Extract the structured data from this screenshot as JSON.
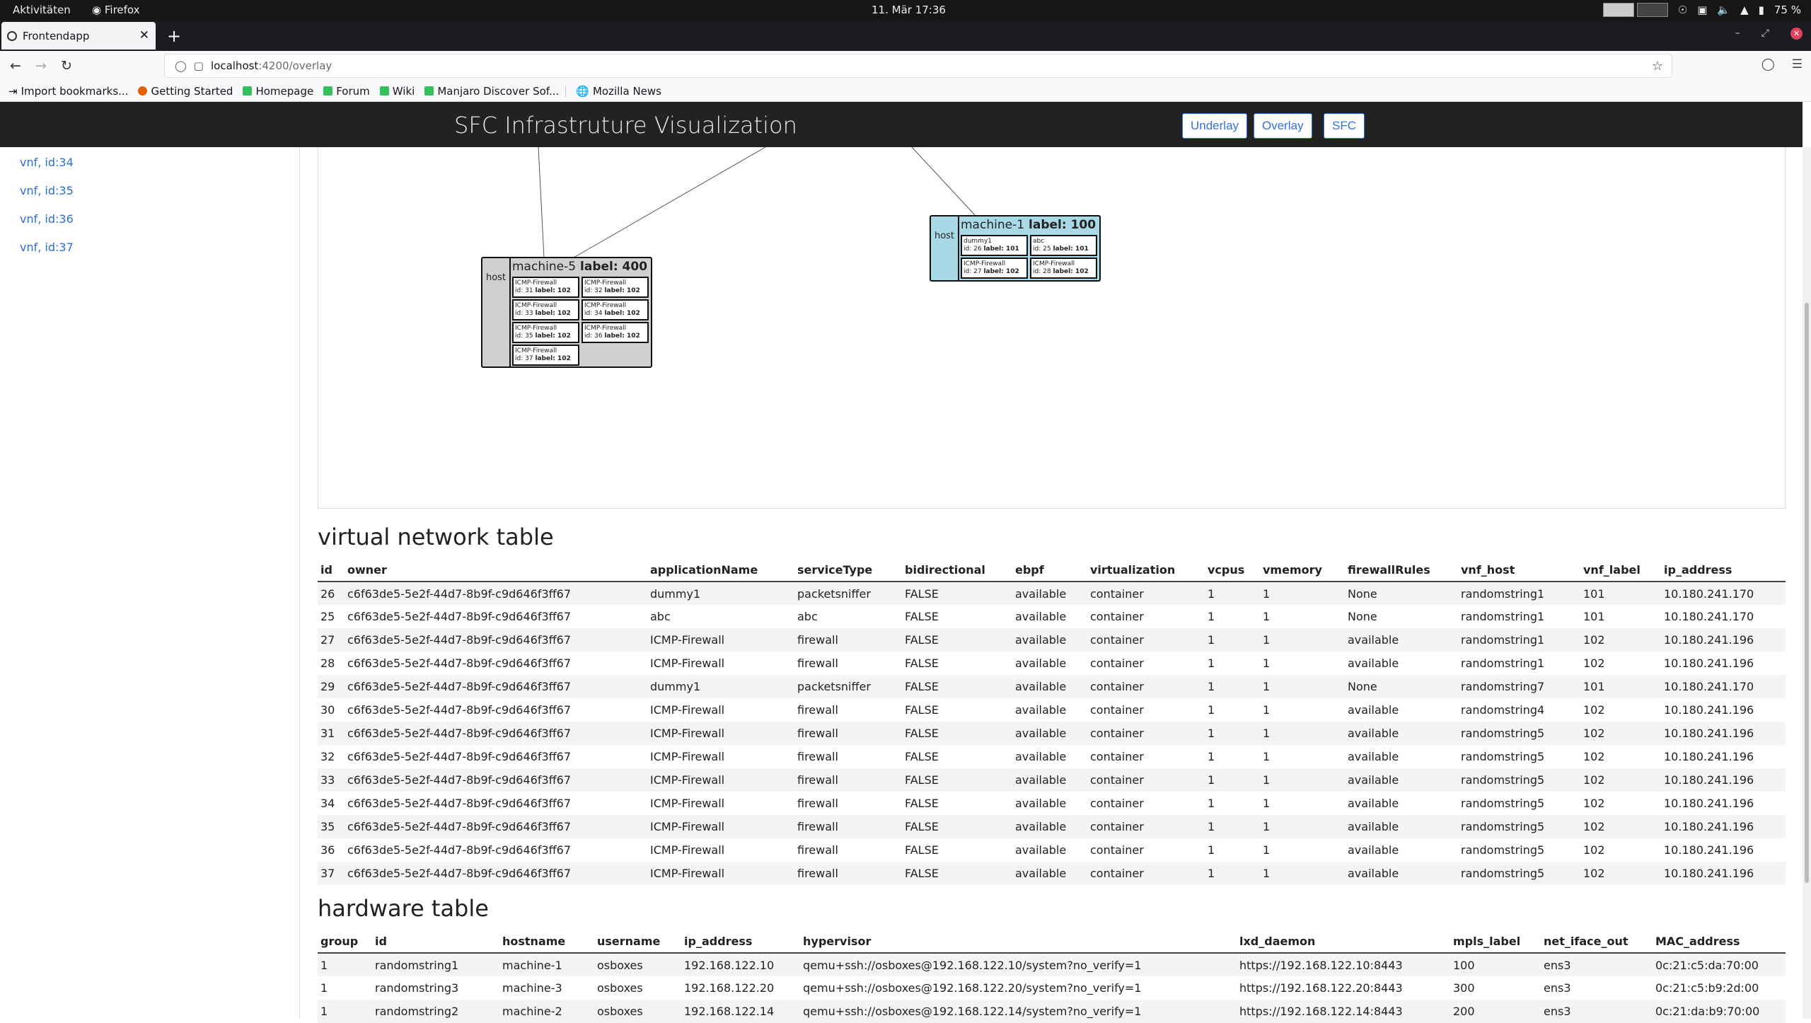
{
  "gnome": {
    "activities": "Aktivitäten",
    "app": "Firefox",
    "clock": "11. Mär  17:36",
    "battery": "75 %"
  },
  "browser": {
    "tab_title": "Frontendapp",
    "url_host": "localhost",
    "url_path": ":4200/overlay"
  },
  "bookmarks": [
    "Import bookmarks...",
    "Getting Started",
    "Homepage",
    "Forum",
    "Wiki",
    "Manjaro Discover Sof...",
    "Mozilla News"
  ],
  "app": {
    "title": "SFC Infrastruture Visualization",
    "buttons": [
      "Underlay",
      "Overlay",
      "SFC"
    ]
  },
  "sidebar": {
    "items": [
      "vnf, id:34",
      "vnf, id:35",
      "vnf, id:36",
      "vnf, id:37"
    ]
  },
  "graph": {
    "host_label": "host",
    "machines": [
      {
        "name": "machine-5",
        "label": "label: 400",
        "vnfs": [
          {
            "name": "ICMP-Firewall",
            "id": "id: 31",
            "label": "label: 102"
          },
          {
            "name": "ICMP-Firewall",
            "id": "id: 32",
            "label": "label: 102"
          },
          {
            "name": "ICMP-Firewall",
            "id": "id: 33",
            "label": "label: 102"
          },
          {
            "name": "ICMP-Firewall",
            "id": "id: 34",
            "label": "label: 102"
          },
          {
            "name": "ICMP-Firewall",
            "id": "id: 35",
            "label": "label: 102"
          },
          {
            "name": "ICMP-Firewall",
            "id": "id: 36",
            "label": "label: 102"
          },
          {
            "name": "ICMP-Firewall",
            "id": "id: 37",
            "label": "label: 102"
          }
        ]
      },
      {
        "name": "machine-1",
        "label": "label: 100",
        "vnfs": [
          {
            "name": "dummy1",
            "id": "id: 26",
            "label": "label: 101"
          },
          {
            "name": "abc",
            "id": "id: 25",
            "label": "label: 101"
          },
          {
            "name": "ICMP-Firewall",
            "id": "id: 27",
            "label": "label: 102"
          },
          {
            "name": "ICMP-Firewall",
            "id": "id: 28",
            "label": "label: 102"
          }
        ]
      }
    ]
  },
  "vnet": {
    "title": "virtual network table",
    "headers": [
      "id",
      "owner",
      "applicationName",
      "serviceType",
      "bidirectional",
      "ebpf",
      "virtualization",
      "vcpus",
      "vmemory",
      "firewallRules",
      "vnf_host",
      "vnf_label",
      "ip_address"
    ],
    "rows": [
      [
        "26",
        "c6f63de5-5e2f-44d7-8b9f-c9d646f3ff67",
        "dummy1",
        "packetsniffer",
        "FALSE",
        "available",
        "container",
        "1",
        "1",
        "None",
        "randomstring1",
        "101",
        "10.180.241.170"
      ],
      [
        "25",
        "c6f63de5-5e2f-44d7-8b9f-c9d646f3ff67",
        "abc",
        "abc",
        "FALSE",
        "available",
        "container",
        "1",
        "1",
        "None",
        "randomstring1",
        "101",
        "10.180.241.170"
      ],
      [
        "27",
        "c6f63de5-5e2f-44d7-8b9f-c9d646f3ff67",
        "ICMP-Firewall",
        "firewall",
        "FALSE",
        "available",
        "container",
        "1",
        "1",
        "available",
        "randomstring1",
        "102",
        "10.180.241.196"
      ],
      [
        "28",
        "c6f63de5-5e2f-44d7-8b9f-c9d646f3ff67",
        "ICMP-Firewall",
        "firewall",
        "FALSE",
        "available",
        "container",
        "1",
        "1",
        "available",
        "randomstring1",
        "102",
        "10.180.241.196"
      ],
      [
        "29",
        "c6f63de5-5e2f-44d7-8b9f-c9d646f3ff67",
        "dummy1",
        "packetsniffer",
        "FALSE",
        "available",
        "container",
        "1",
        "1",
        "None",
        "randomstring7",
        "101",
        "10.180.241.170"
      ],
      [
        "30",
        "c6f63de5-5e2f-44d7-8b9f-c9d646f3ff67",
        "ICMP-Firewall",
        "firewall",
        "FALSE",
        "available",
        "container",
        "1",
        "1",
        "available",
        "randomstring4",
        "102",
        "10.180.241.196"
      ],
      [
        "31",
        "c6f63de5-5e2f-44d7-8b9f-c9d646f3ff67",
        "ICMP-Firewall",
        "firewall",
        "FALSE",
        "available",
        "container",
        "1",
        "1",
        "available",
        "randomstring5",
        "102",
        "10.180.241.196"
      ],
      [
        "32",
        "c6f63de5-5e2f-44d7-8b9f-c9d646f3ff67",
        "ICMP-Firewall",
        "firewall",
        "FALSE",
        "available",
        "container",
        "1",
        "1",
        "available",
        "randomstring5",
        "102",
        "10.180.241.196"
      ],
      [
        "33",
        "c6f63de5-5e2f-44d7-8b9f-c9d646f3ff67",
        "ICMP-Firewall",
        "firewall",
        "FALSE",
        "available",
        "container",
        "1",
        "1",
        "available",
        "randomstring5",
        "102",
        "10.180.241.196"
      ],
      [
        "34",
        "c6f63de5-5e2f-44d7-8b9f-c9d646f3ff67",
        "ICMP-Firewall",
        "firewall",
        "FALSE",
        "available",
        "container",
        "1",
        "1",
        "available",
        "randomstring5",
        "102",
        "10.180.241.196"
      ],
      [
        "35",
        "c6f63de5-5e2f-44d7-8b9f-c9d646f3ff67",
        "ICMP-Firewall",
        "firewall",
        "FALSE",
        "available",
        "container",
        "1",
        "1",
        "available",
        "randomstring5",
        "102",
        "10.180.241.196"
      ],
      [
        "36",
        "c6f63de5-5e2f-44d7-8b9f-c9d646f3ff67",
        "ICMP-Firewall",
        "firewall",
        "FALSE",
        "available",
        "container",
        "1",
        "1",
        "available",
        "randomstring5",
        "102",
        "10.180.241.196"
      ],
      [
        "37",
        "c6f63de5-5e2f-44d7-8b9f-c9d646f3ff67",
        "ICMP-Firewall",
        "firewall",
        "FALSE",
        "available",
        "container",
        "1",
        "1",
        "available",
        "randomstring5",
        "102",
        "10.180.241.196"
      ]
    ]
  },
  "hw": {
    "title": "hardware table",
    "headers": [
      "group",
      "id",
      "hostname",
      "username",
      "ip_address",
      "hypervisor",
      "lxd_daemon",
      "mpls_label",
      "net_iface_out",
      "MAC_address"
    ],
    "rows": [
      [
        "1",
        "randomstring1",
        "machine-1",
        "osboxes",
        "192.168.122.10",
        "qemu+ssh://osboxes@192.168.122.10/system?no_verify=1",
        "https://192.168.122.10:8443",
        "100",
        "ens3",
        "0c:21:c5:da:70:00"
      ],
      [
        "1",
        "randomstring3",
        "machine-3",
        "osboxes",
        "192.168.122.20",
        "qemu+ssh://osboxes@192.168.122.20/system?no_verify=1",
        "https://192.168.122.20:8443",
        "300",
        "ens3",
        "0c:21:c5:b9:2d:00"
      ],
      [
        "1",
        "randomstring2",
        "machine-2",
        "osboxes",
        "192.168.122.14",
        "qemu+ssh://osboxes@192.168.122.14/system?no_verify=1",
        "https://192.168.122.14:8443",
        "200",
        "ens3",
        "0c:21:da:b9:70:00"
      ]
    ]
  }
}
